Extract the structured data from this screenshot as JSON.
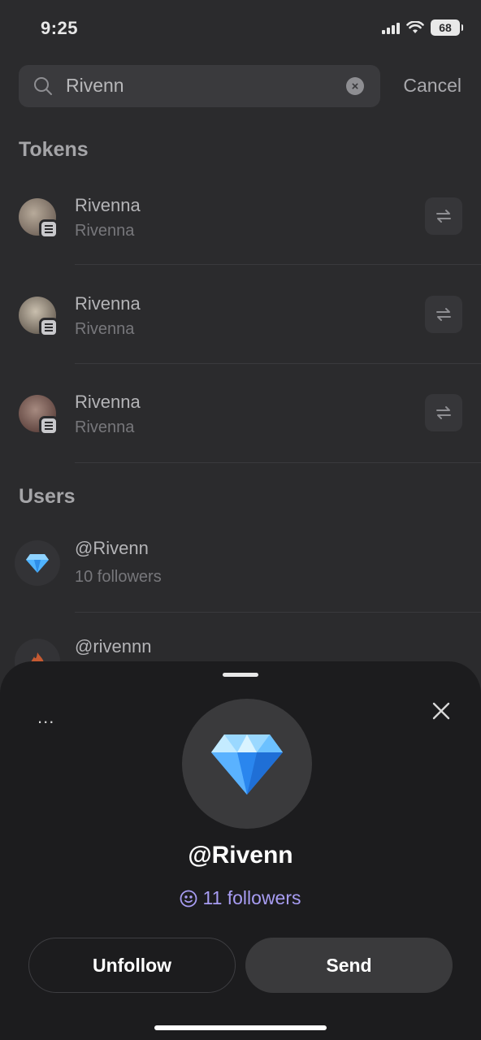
{
  "status": {
    "time": "9:25",
    "battery": "68"
  },
  "search": {
    "value": "Rivenn",
    "placeholder": "Search",
    "cancel_label": "Cancel"
  },
  "sections": {
    "tokens_title": "Tokens",
    "users_title": "Users"
  },
  "tokens": [
    {
      "name": "Rivenna",
      "symbol": "Rivenna",
      "avatar_color": "#7a6a5e"
    },
    {
      "name": "Rivenna",
      "symbol": "Rivenna",
      "avatar_color": "#8a7f70"
    },
    {
      "name": "Rivenna",
      "symbol": "Rivenna",
      "avatar_color": "#6e4a44"
    }
  ],
  "users": [
    {
      "handle": "@Rivenn",
      "followers": "10 followers",
      "icon": "gem-icon"
    },
    {
      "handle": "@rivennn",
      "followers": "",
      "icon": "fire-icon"
    }
  ],
  "sheet": {
    "more_label": "...",
    "handle": "@Rivenn",
    "followers": "11 followers",
    "unfollow_label": "Unfollow",
    "send_label": "Send",
    "accent_color": "#a79cf2"
  }
}
